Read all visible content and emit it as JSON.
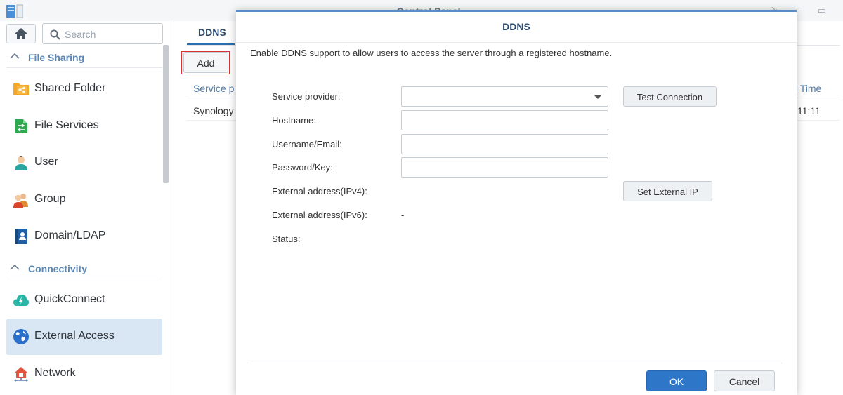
{
  "window": {
    "title": "Control Panel",
    "app_icon": "control-panel-icon",
    "controls": [
      "pin-icon",
      "minimize-icon",
      "maximize-icon"
    ]
  },
  "sidebar": {
    "home_icon": "home-icon",
    "search": {
      "placeholder": "Search",
      "icon": "search-icon"
    },
    "sections": [
      {
        "label": "File Sharing",
        "items": [
          {
            "label": "Shared Folder",
            "icon": "shared-folder-icon"
          },
          {
            "label": "File Services",
            "icon": "file-services-icon"
          },
          {
            "label": "User",
            "icon": "user-icon"
          },
          {
            "label": "Group",
            "icon": "group-icon"
          },
          {
            "label": "Domain/LDAP",
            "icon": "domain-ldap-icon"
          }
        ]
      },
      {
        "label": "Connectivity",
        "items": [
          {
            "label": "QuickConnect",
            "icon": "quickconnect-icon"
          },
          {
            "label": "External Access",
            "icon": "external-access-icon",
            "active": true
          },
          {
            "label": "Network",
            "icon": "network-icon"
          }
        ]
      }
    ]
  },
  "main": {
    "tab": "DDNS",
    "add_label": "Add",
    "grid": {
      "headers": [
        "Service p",
        "l Time"
      ],
      "row": [
        "Synology",
        "11:11"
      ]
    }
  },
  "dialog": {
    "title": "DDNS",
    "description": "Enable DDNS support to allow users to access the server through a registered hostname.",
    "fields": {
      "service_provider": {
        "label": "Service provider:",
        "value": ""
      },
      "hostname": {
        "label": "Hostname:",
        "value": ""
      },
      "username": {
        "label": "Username/Email:",
        "value": ""
      },
      "password": {
        "label": "Password/Key:",
        "value": ""
      },
      "ipv4": {
        "label": "External address(IPv4):",
        "value": ""
      },
      "ipv6": {
        "label": "External address(IPv6):",
        "value": "-"
      },
      "status": {
        "label": "Status:",
        "value": ""
      }
    },
    "test_connection_label": "Test Connection",
    "set_external_ip_label": "Set External IP",
    "ok_label": "OK",
    "cancel_label": "Cancel"
  },
  "colors": {
    "accent": "#2e76c8",
    "section_header": "#5a87b7",
    "active_item_bg": "#d9e6f4",
    "highlight_border": "#d93131"
  }
}
